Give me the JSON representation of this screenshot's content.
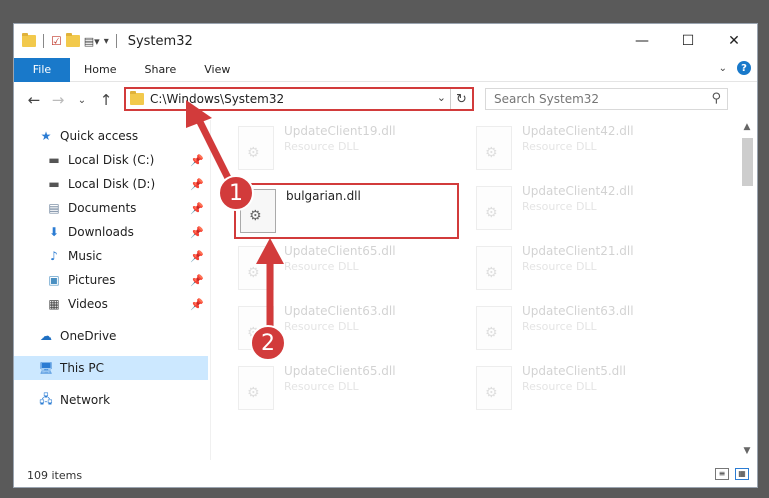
{
  "window": {
    "title": "System32"
  },
  "ribbon": {
    "file": "File",
    "tabs": [
      "Home",
      "Share",
      "View"
    ],
    "help": "?"
  },
  "nav": {
    "address": "C:\\Windows\\System32",
    "search_placeholder": "Search System32"
  },
  "sidebar": {
    "items": [
      {
        "label": "Quick access",
        "icon": "star-icon",
        "pinned": false
      },
      {
        "label": "Local Disk (C:)",
        "icon": "drive-icon",
        "pinned": true
      },
      {
        "label": "Local Disk (D:)",
        "icon": "drive-icon",
        "pinned": true
      },
      {
        "label": "Documents",
        "icon": "documents-icon",
        "pinned": true
      },
      {
        "label": "Downloads",
        "icon": "download-icon",
        "pinned": true
      },
      {
        "label": "Music",
        "icon": "music-icon",
        "pinned": true
      },
      {
        "label": "Pictures",
        "icon": "pictures-icon",
        "pinned": true
      },
      {
        "label": "Videos",
        "icon": "videos-icon",
        "pinned": true
      },
      {
        "label": "OneDrive",
        "icon": "cloud-icon",
        "pinned": false
      },
      {
        "label": "This PC",
        "icon": "computer-icon",
        "pinned": false,
        "selected": true
      },
      {
        "label": "Network",
        "icon": "network-icon",
        "pinned": false
      }
    ]
  },
  "files": {
    "highlighted": {
      "name": "bulgarian.dll"
    },
    "faded": [
      {
        "name": "UpdateClient19.dll",
        "type": "Resource DLL"
      },
      {
        "name": "UpdateClient42.dll",
        "type": "Resource DLL"
      },
      {
        "name": "UpdateClient42.dll",
        "type": "Resource DLL"
      },
      {
        "name": "UpdateClient65.dll",
        "type": "Resource DLL"
      },
      {
        "name": "UpdateClient21.dll",
        "type": "Resource DLL"
      },
      {
        "name": "UpdateClient63.dll",
        "type": "Resource DLL"
      },
      {
        "name": "UpdateClient63.dll",
        "type": "Resource DLL"
      },
      {
        "name": "UpdateClient65.dll",
        "type": "Resource DLL"
      },
      {
        "name": "UpdateClient5.dll",
        "type": "Resource DLL"
      }
    ]
  },
  "status": {
    "count": "109 items"
  },
  "annotations": {
    "step1": "1",
    "step2": "2",
    "color": "#d23b3b"
  }
}
